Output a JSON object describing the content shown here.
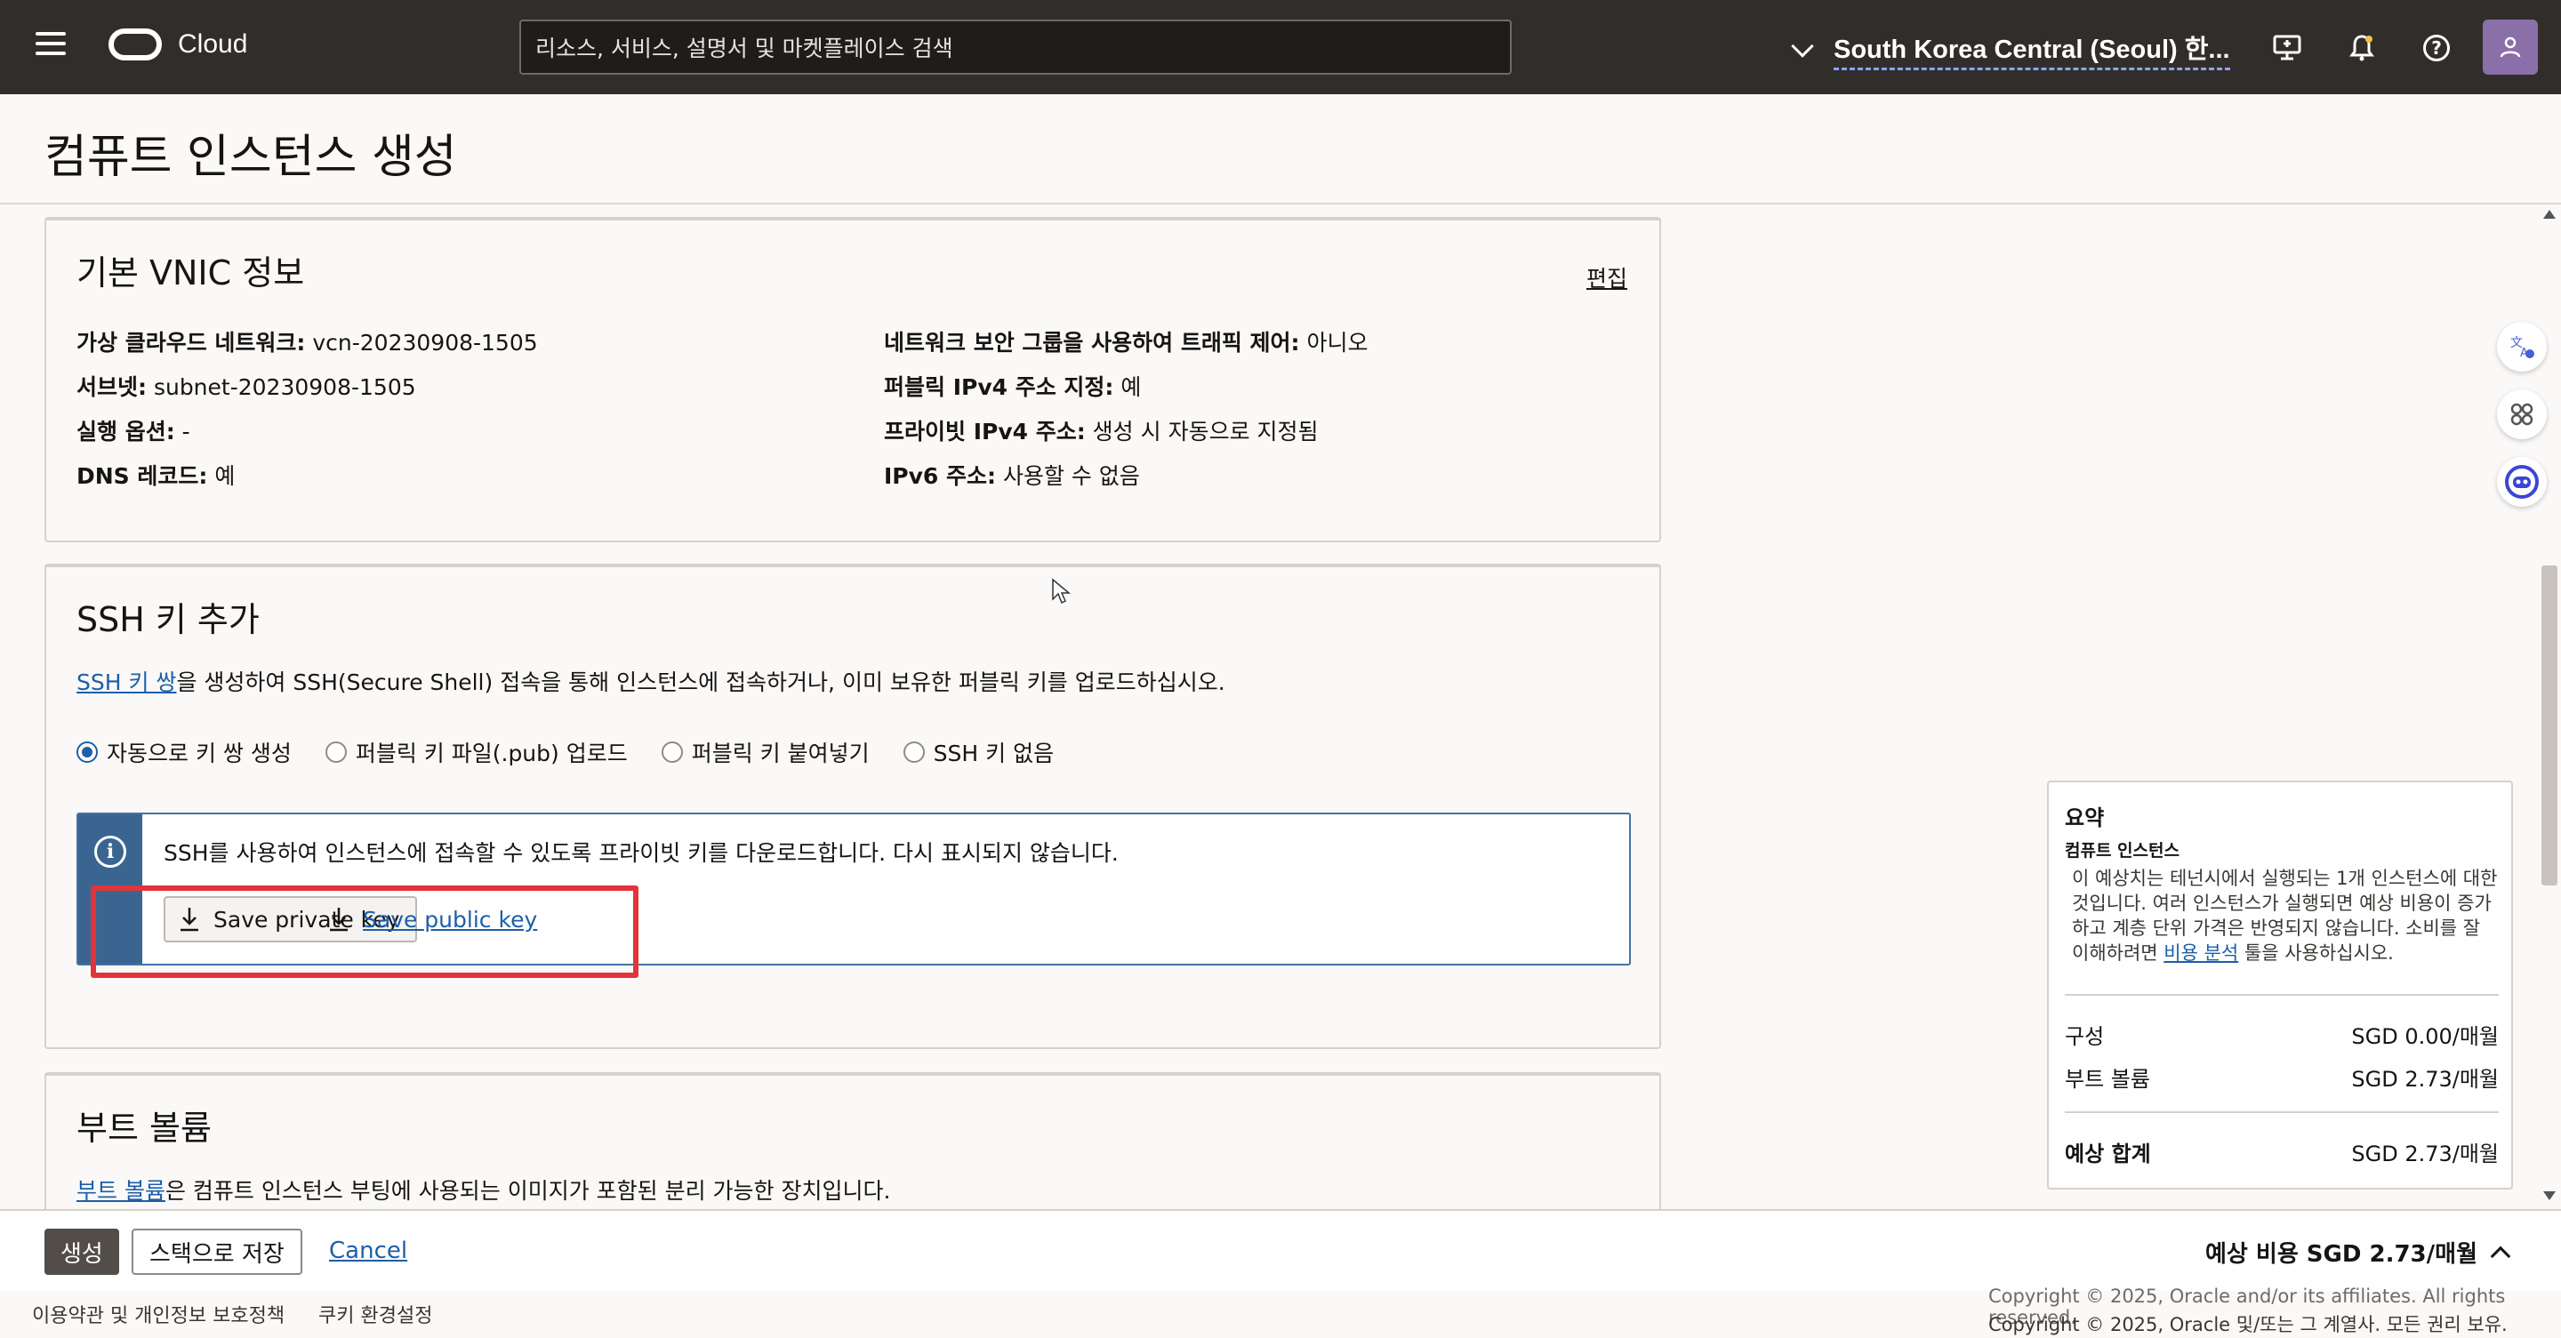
{
  "header": {
    "brand": "Cloud",
    "search_placeholder": "리소스, 서비스, 설명서 및 마켓플레이스 검색",
    "region": "South Korea Central (Seoul) 한...",
    "icons": [
      "menu-icon",
      "monitor-icon",
      "bell-icon",
      "help-icon",
      "user-icon"
    ],
    "help_glyph": "?"
  },
  "page": {
    "title": "컴퓨트 인스턴스 생성"
  },
  "vnic": {
    "title": "기본 VNIC 정보",
    "edit_label": "편집",
    "left": [
      {
        "key": "가상 클라우드 네트워크:",
        "value": " vcn-20230908-1505"
      },
      {
        "key": "서브넷:",
        "value": " subnet-20230908-1505"
      },
      {
        "key": "실행 옵션:",
        "value": " -"
      },
      {
        "key": "DNS 레코드:",
        "value": " 예"
      }
    ],
    "right": [
      {
        "key": "네트워크 보안 그룹을 사용하여 트래픽 제어:",
        "value": " 아니오"
      },
      {
        "key": "퍼블릭 IPv4 주소 지정:",
        "value": " 예"
      },
      {
        "key": "프라이빗 IPv4 주소:",
        "value": " 생성 시 자동으로 지정됨"
      },
      {
        "key": "IPv6 주소:",
        "value": " 사용할 수 없음"
      }
    ]
  },
  "ssh": {
    "title": "SSH 키 추가",
    "desc_link": "SSH 키 쌍",
    "desc_rest": "을 생성하여 SSH(Secure Shell) 접속을 통해 인스턴스에 접속하거나, 이미 보유한 퍼블릭 키를 업로드하십시오.",
    "options": [
      {
        "label": "자동으로 키 쌍 생성",
        "selected": true
      },
      {
        "label": "퍼블릭 키 파일(.pub) 업로드",
        "selected": false
      },
      {
        "label": "퍼블릭 키 붙여넣기",
        "selected": false
      },
      {
        "label": "SSH 키 없음",
        "selected": false
      }
    ],
    "info_glyph": "i",
    "info_text": "SSH를 사용하여 인스턴스에 접속할 수 있도록 프라이빗 키를 다운로드합니다. 다시 표시되지 않습니다.",
    "save_private_label": "Save private key",
    "save_public_label": "Save public key"
  },
  "boot": {
    "title": "부트 볼륨",
    "desc_link": "부트 볼륨",
    "desc_rest": "은 컴퓨트 인스턴스 부팅에 사용되는 이미지가 포함된 분리 가능한 장치입니다."
  },
  "summary": {
    "title": "요약",
    "subtitle": "컴퓨트 인스턴스",
    "desc_pre": "이 예상치는 테넌시에서 실행되는 1개 인스턴스에 대한 것입니다. 여러 인스턴스가 실행되면 예상 비용이 증가하고 계층 단위 가격은 반영되지 않습니다. 소비를 잘 이해하려면 ",
    "desc_link": "비용 분석",
    "desc_post": " 툴을 사용하십시오.",
    "rows": [
      {
        "label": "구성",
        "value": "SGD 0.00/매월"
      },
      {
        "label": "부트 볼륨",
        "value": "SGD 2.73/매월"
      }
    ],
    "total_label": "예상 합계",
    "total_value": "SGD 2.73/매월"
  },
  "actions": {
    "create_label": "생성",
    "save_stack_label": "스택으로 저장",
    "cancel_label": "Cancel",
    "estimated_cost": "예상 비용 SGD 2.73/매월"
  },
  "footer": {
    "terms": "이용약관 및 개인정보 보호정책",
    "cookies": "쿠키 환경설정",
    "copyright_overlap": "Copyright © 2025, Oracle and/or its affiliates. All rights reserved.",
    "copyright": "Copyright © 2025, Oracle 및/또는 그 계열사. 모든 권리 보유."
  },
  "colors": {
    "header_bg": "#312d2a",
    "link": "#1d5ea8",
    "info_strip": "#3a6591",
    "highlight": "#e2343b",
    "create_button": "#524d48"
  }
}
